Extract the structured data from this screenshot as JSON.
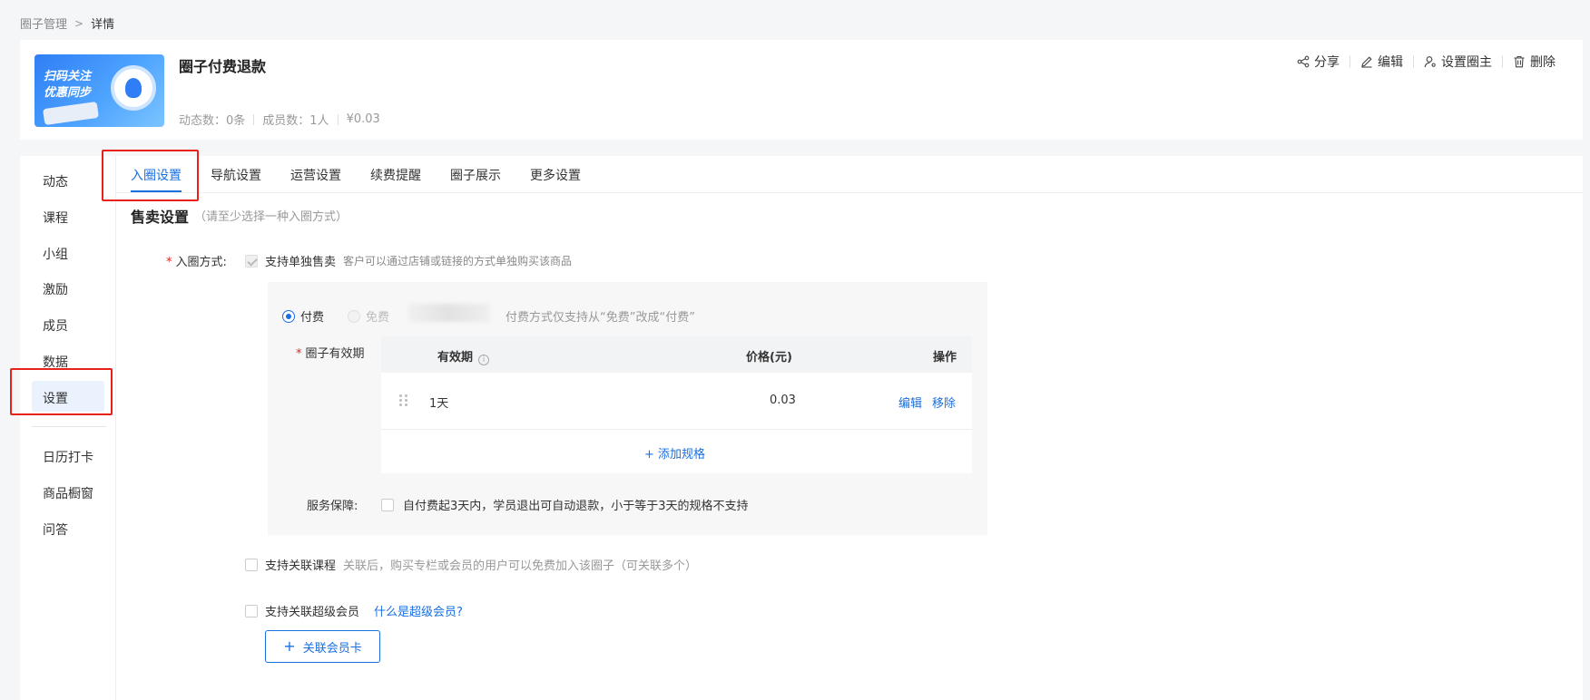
{
  "breadcrumb": {
    "parent": "圈子管理",
    "separator": ">",
    "current": "详情"
  },
  "cover": {
    "line1": "扫码关注",
    "line2": "优惠同步"
  },
  "circle": {
    "title": "圈子付费退款",
    "posts": "动态数：0条",
    "members": "成员数：1人",
    "price": "¥0.03"
  },
  "actions": {
    "share": "分享",
    "edit": "编辑",
    "set_owner": "设置圈主",
    "delete": "删除"
  },
  "left_nav": {
    "items": [
      "动态",
      "课程",
      "小组",
      "激励",
      "成员",
      "数据",
      "设置"
    ],
    "extra": [
      "日历打卡",
      "商品橱窗",
      "问答"
    ],
    "active": "设置"
  },
  "tabs": {
    "items": [
      "入圈设置",
      "导航设置",
      "运营设置",
      "续费提醒",
      "圈子展示",
      "更多设置"
    ],
    "active": "入圈设置"
  },
  "sale": {
    "title": "售卖设置",
    "hint": "（请至少选择一种入圈方式）",
    "join_label": "入圈方式:",
    "single_label": "支持单独售卖",
    "single_hint": "客户可以通过店铺或链接的方式单独购买该商品",
    "pay_label": "付费",
    "free_label": "免费",
    "pay_hint": "付费方式仅支持从“免费”改成“付费”",
    "validity_label": "圈子有效期",
    "table": {
      "headers": [
        "有效期",
        "价格(元)",
        "操作"
      ],
      "rows": [
        {
          "period": "1天",
          "price": "0.03",
          "edit": "编辑",
          "remove": "移除"
        }
      ],
      "add_spec": "+ 添加规格"
    },
    "service_label": "服务保障:",
    "service_text": "自付费起3天内，学员退出可自动退款，小于等于3天的规格不支持",
    "course_label": "支持关联课程",
    "course_hint": "关联后，购买专栏或会员的用户可以免费加入该圈子（可关联多个）",
    "member_label": "支持关联超级会员",
    "member_link": "什么是超级会员?",
    "member_button": "关联会员卡"
  },
  "colors": {
    "accent": "#1a6fe0",
    "highlight": "#e8221b"
  }
}
